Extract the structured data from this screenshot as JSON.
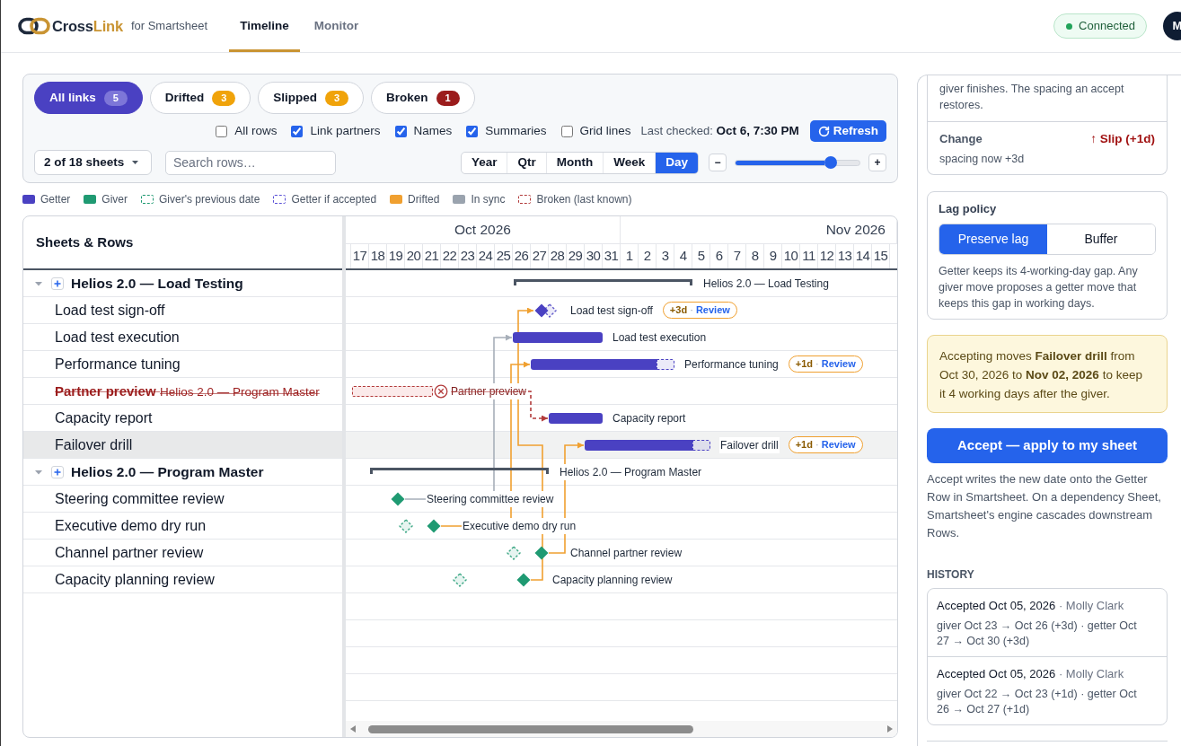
{
  "header": {
    "brand": {
      "prefix": "Cross",
      "highlight": "Link",
      "tagline": "for Smartsheet"
    },
    "tabs": [
      {
        "label": "Timeline",
        "selected": true
      },
      {
        "label": "Monitor",
        "selected": false
      }
    ],
    "connection": {
      "label": "Connected",
      "online": true
    },
    "avatar": {
      "initial": "M"
    }
  },
  "toolbar": {
    "filters": [
      {
        "label": "All links",
        "count": "5",
        "selected": true,
        "color": "#7d76d8"
      },
      {
        "label": "Drifted",
        "count": "3",
        "selected": false,
        "color": "#f0a30a"
      },
      {
        "label": "Slipped",
        "count": "3",
        "selected": false,
        "color": "#f0a30a"
      },
      {
        "label": "Broken",
        "count": "1",
        "selected": false,
        "color": "#9b1c1c"
      }
    ],
    "options": [
      {
        "label": "All rows",
        "checked": false
      },
      {
        "label": "Link partners",
        "checked": true
      },
      {
        "label": "Names",
        "checked": true
      },
      {
        "label": "Summaries",
        "checked": true
      },
      {
        "label": "Grid lines",
        "checked": false
      }
    ],
    "last_checked": {
      "label": "Last checked:",
      "value": "Oct 6, 7:30 PM"
    },
    "refresh": {
      "label": "Refresh"
    },
    "sheet_picker": {
      "value": "2 of 18 sheets"
    },
    "search": {
      "placeholder": "Search rows…"
    },
    "scales": [
      {
        "label": "Year",
        "selected": false
      },
      {
        "label": "Qtr",
        "selected": false
      },
      {
        "label": "Month",
        "selected": false
      },
      {
        "label": "Week",
        "selected": false
      },
      {
        "label": "Day",
        "selected": true
      }
    ],
    "zoom": {
      "minus": "−",
      "plus": "+",
      "level": 0.77
    }
  },
  "legend": [
    {
      "label": "Getter",
      "kind": "solid",
      "color": "#4a41c2"
    },
    {
      "label": "Giver",
      "kind": "solid",
      "color": "#1f9a72"
    },
    {
      "label": "Giver's previous date",
      "kind": "dashed",
      "color": "#1f9a72"
    },
    {
      "label": "Getter if accepted",
      "kind": "dashed",
      "color": "#5b52d6"
    },
    {
      "label": "Drifted",
      "kind": "solid",
      "color": "#f0a030"
    },
    {
      "label": "In sync",
      "kind": "solid",
      "color": "#9aa3ae"
    },
    {
      "label": "Broken (last known)",
      "kind": "dashed",
      "color": "#b23b3b"
    }
  ],
  "gantt": {
    "heading": "Sheets & Rows",
    "months": [
      {
        "label": "Oct 2026",
        "days": [
          "17",
          "18",
          "19",
          "20",
          "21",
          "22",
          "23",
          "24",
          "25",
          "26",
          "27",
          "28",
          "29",
          "30",
          "31"
        ]
      },
      {
        "label": "Nov 2026",
        "days": [
          "1",
          "2",
          "3",
          "4",
          "5",
          "6",
          "7",
          "8",
          "9",
          "10",
          "11",
          "12",
          "13",
          "14",
          "15"
        ]
      }
    ],
    "groups": [
      {
        "name": "Helios 2.0 — Load Testing",
        "expanded": true,
        "summary_label": "Helios 2.0 — Load Testing",
        "children": [
          {
            "name": "Load test sign-off",
            "selected": false,
            "kind": "milestone",
            "color": "#4a41c2",
            "ghost": true,
            "label": "Load test sign-off",
            "link": {
              "kind": "drifted"
            },
            "badge": {
              "shift": "+3d",
              "separator": "·",
              "action": "Review"
            }
          },
          {
            "name": "Load test execution",
            "selected": false,
            "kind": "bar",
            "color": "#4a41c2",
            "ghost": false,
            "label": "Load test execution",
            "link": {
              "kind": "in_sync"
            }
          },
          {
            "name": "Performance tuning",
            "selected": false,
            "kind": "bar",
            "color": "#4a41c2",
            "ghost": true,
            "label": "Performance tuning",
            "link": {
              "kind": "drifted"
            },
            "badge": {
              "shift": "+1d",
              "separator": "·",
              "action": "Review"
            }
          },
          {
            "name": "Partner preview",
            "selected": false,
            "kind": "broken",
            "source": "Helios 2.0 — Program Master",
            "label": "Partner preview"
          },
          {
            "name": "Capacity report",
            "selected": false,
            "kind": "bar",
            "color": "#4a41c2",
            "ghost": false,
            "label": "Capacity report",
            "link": {
              "kind": "broken"
            }
          },
          {
            "name": "Failover drill",
            "selected": true,
            "kind": "bar",
            "color": "#4a41c2",
            "ghost": true,
            "label": "Failover drill",
            "link": {
              "kind": "drifted"
            },
            "badge": {
              "shift": "+1d",
              "separator": "·",
              "action": "Review"
            }
          }
        ]
      },
      {
        "name": "Helios 2.0 — Program Master",
        "expanded": true,
        "summary_label": "Helios 2.0 — Program Master",
        "children": [
          {
            "name": "Steering committee review",
            "selected": false,
            "kind": "milestone",
            "color": "#1f9a72",
            "ghost": false,
            "label": "Steering committee review"
          },
          {
            "name": "Executive demo dry run",
            "selected": false,
            "kind": "milestone",
            "color": "#1f9a72",
            "ghost": true,
            "label": "Executive demo dry run"
          },
          {
            "name": "Channel partner review",
            "selected": false,
            "kind": "milestone",
            "color": "#1f9a72",
            "ghost": true,
            "label": "Channel partner review"
          },
          {
            "name": "Capacity planning review",
            "selected": false,
            "kind": "milestone",
            "color": "#1f9a72",
            "ghost": true,
            "label": "Capacity planning review"
          }
        ]
      }
    ]
  },
  "detail": {
    "explanation": "giver finishes. The spacing an accept restores.",
    "change": {
      "label": "Change",
      "value": "↑ Slip (+1d)",
      "note": "spacing now +3d"
    },
    "lag_policy": {
      "title": "Lag policy",
      "options": [
        {
          "label": "Preserve lag",
          "selected": true
        },
        {
          "label": "Buffer",
          "selected": false
        }
      ],
      "description": "Getter keeps its 4-working-day gap. Any giver move proposes a getter move that keeps this gap in working days."
    },
    "notice": "Accepting moves **Failover drill** from Oct 30, 2026 to **Nov 02, 2026** to keep it 4 working days after the giver.",
    "accept_button": "Accept — apply to my sheet",
    "accept_note": "Accept writes the new date onto the Getter Row in Smartsheet. On a dependency Sheet, Smartsheet's engine cascades downstream Rows.",
    "history": {
      "heading": "HISTORY",
      "entries": [
        {
          "action": "Accepted Oct 05, 2026",
          "separator": "·",
          "user": "Molly Clark",
          "details": "giver Oct 23 → Oct 26 (+3d) · getter Oct 27 → Oct 30 (+3d)"
        },
        {
          "action": "Accepted Oct 05, 2026",
          "separator": "·",
          "user": "Molly Clark",
          "details": "giver Oct 22 → Oct 23 (+1d) · getter Oct 26 → Oct 27 (+1d)"
        }
      ]
    }
  }
}
